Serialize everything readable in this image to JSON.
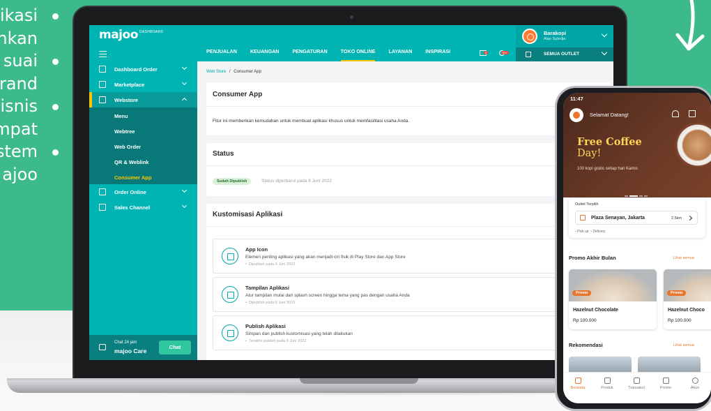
{
  "side_text": [
    "likasi",
    "nkan",
    "suai",
    "rand",
    "isnis",
    "mpat",
    "stem",
    "ajoo"
  ],
  "app": {
    "logo": "majoo",
    "logo_sub": "DASHBOARD",
    "nav": [
      "PENJUALAN",
      "KEUANGAN",
      "PENGATURAN",
      "TOKO ONLINE",
      "LAYANAN",
      "INSPIRASI"
    ],
    "nav_active": "TOKO ONLINE",
    "badge_mail": "8",
    "badge_notif": "99+",
    "user_name": "Barakopi",
    "user_sub": "Alan Sutedja",
    "outlet": "SEMUA OUTLET"
  },
  "sidebar": {
    "items": [
      {
        "label": "Dashboard Order",
        "icon": "clipboard-icon"
      },
      {
        "label": "Marketplace",
        "icon": "marketplace-icon"
      },
      {
        "label": "Webstore",
        "icon": "webstore-icon"
      },
      {
        "label": "Order Online",
        "icon": "order-online-icon"
      },
      {
        "label": "Sales Channel",
        "icon": "sales-channel-icon"
      }
    ],
    "sub_items": [
      "Menu",
      "Webtree",
      "Web Order",
      "QR & Weblink",
      "Consumer App"
    ],
    "chat_small": "Chat 24 jam",
    "chat_big": "majoo Care",
    "chat_button": "Chat"
  },
  "content": {
    "breadcrumb_link": "Web Store",
    "breadcrumb_sep": "/",
    "breadcrumb_current": "Consumer App",
    "card1_title": "Consumer App",
    "card1_text": "Fitur ini memberikan kemudahan untuk membuat aplikasi khusus untuk memfasilitasi usaha Anda.",
    "status_title": "Status",
    "status_pill": "Sudah Dipublish",
    "status_note": "Status diperbarui pada 8 Juni 2022",
    "custom_title": "Kustomisasi Aplikasi",
    "features": [
      {
        "title": "App Icon",
        "desc": "Elemen penting aplikasi yang akan menjadi ciri fisik di Play Store dan App Store",
        "date": "Dipublish pada 6 Juni 2022",
        "icon": "box-icon"
      },
      {
        "title": "Tampilan Aplikasi",
        "desc": "Atur tampilan mulai dari splash screen hingga tema yang pas dengan usaha Anda",
        "date": "Dipublish pada 6 Juni 2022",
        "icon": "layout-icon"
      },
      {
        "title": "Publish Aplikasi",
        "desc": "Simpan dan publish kustomisasi yang telah dilakukan",
        "date": "Terakhir publish pada 8 Juni 2022",
        "icon": "store-icon"
      }
    ]
  },
  "phone": {
    "time": "11:47",
    "greeting": "Selamat Datang!",
    "promo_line1": "Free Coffee",
    "promo_line2": "Day!",
    "promo_sub": "100 kopi gratis setiap hari Kamis",
    "outlet_label": "Outlet Terpilih",
    "outlet_name": "Plaza Senayan, Jakarta",
    "outlet_distance": "2,5km",
    "mode_pickup": "Pick up",
    "mode_delivery": "Delivery",
    "section1": "Promo Akhir Bulan",
    "see_all": "Lihat semua",
    "products": [
      {
        "badge": "Promo",
        "name": "Hazelnut Chocolate",
        "price": "Rp 100.000"
      },
      {
        "badge": "Promo",
        "name": "Hazelnut Choco",
        "price": "Rp 100.000"
      }
    ],
    "section2": "Rekomendasi",
    "nav": [
      "Beranda",
      "Produk",
      "Transaksi",
      "Promo",
      "Akun"
    ]
  },
  "colors": {
    "brand": "#00b4b4",
    "accent": "#ffc400",
    "bg_green": "#3dba8c",
    "phone_accent": "#e8762f"
  }
}
